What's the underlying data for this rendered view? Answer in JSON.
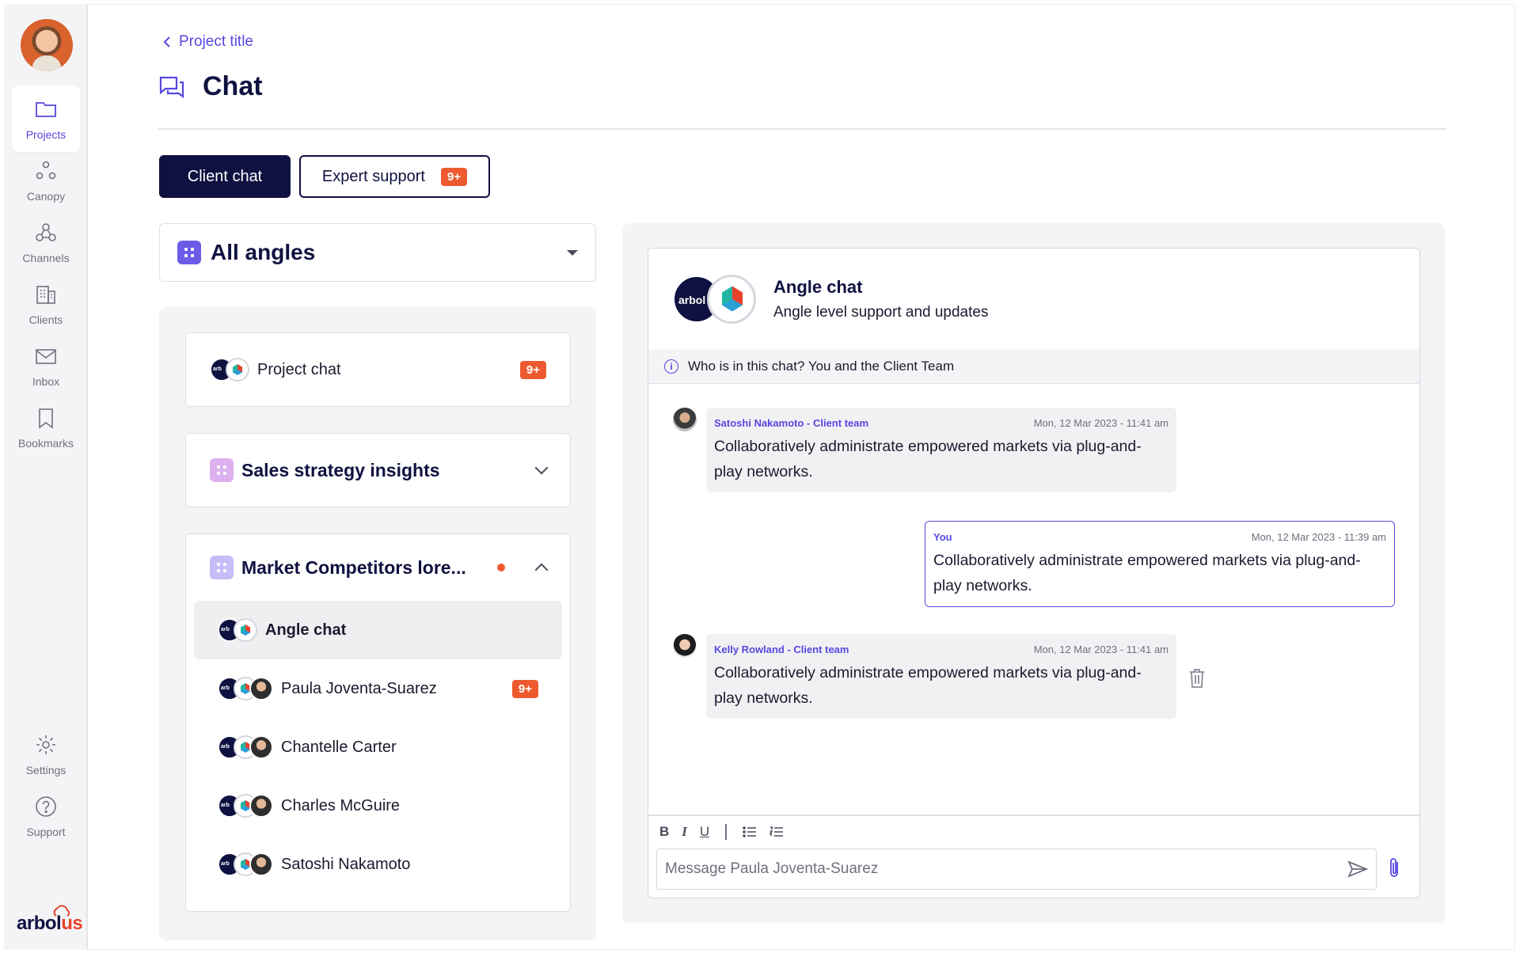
{
  "sidebar": {
    "items": [
      {
        "label": "Projects",
        "icon": "folder-icon",
        "active": true
      },
      {
        "label": "Canopy",
        "icon": "canopy-icon"
      },
      {
        "label": "Channels",
        "icon": "channels-icon"
      },
      {
        "label": "Clients",
        "icon": "building-icon"
      },
      {
        "label": "Inbox",
        "icon": "mail-icon"
      },
      {
        "label": "Bookmarks",
        "icon": "bookmark-icon"
      },
      {
        "label": "Settings",
        "icon": "gear-icon"
      },
      {
        "label": "Support",
        "icon": "help-icon"
      }
    ],
    "logo": {
      "prefix": "arbol",
      "suffix": "us"
    }
  },
  "header": {
    "back_label": "Project title",
    "title": "Chat"
  },
  "tabs": {
    "client_chat": "Client chat",
    "expert_support": "Expert support",
    "expert_support_badge": "9+"
  },
  "angle_select": {
    "value": "All angles"
  },
  "list": {
    "project_chat": {
      "label": "Project chat",
      "badge": "9+"
    },
    "sales_group": {
      "label": "Sales strategy insights"
    },
    "market_group": {
      "label": "Market Competitors lore...",
      "items": [
        {
          "label": "Angle chat",
          "selected": true
        },
        {
          "label": "Paula Joventa-Suarez",
          "badge": "9+"
        },
        {
          "label": "Chantelle Carter"
        },
        {
          "label": "Charles McGuire"
        },
        {
          "label": "Satoshi Nakamoto"
        }
      ]
    }
  },
  "chat": {
    "title": "Angle chat",
    "subtitle": "Angle level support and updates",
    "info": "Who is in this chat? You and the Client Team",
    "messages": [
      {
        "sender": "Satoshi Nakamoto - Client team",
        "time": "Mon, 12 Mar 2023 - 11:41 am",
        "text": "Collaboratively administrate empowered markets via plug-and-play networks.",
        "direction": "in"
      },
      {
        "sender": "You",
        "time": "Mon, 12 Mar 2023 - 11:39 am",
        "text": "Collaboratively administrate empowered markets via plug-and-play networks.",
        "direction": "out"
      },
      {
        "sender": "Kelly Rowland - Client team",
        "time": "Mon, 12 Mar 2023 - 11:41 am",
        "text": "Collaboratively administrate empowered markets via plug-and-play networks.",
        "direction": "in"
      }
    ],
    "composer": {
      "format_bold": "B",
      "format_italic": "I",
      "format_underline": "U",
      "placeholder": "Message Paula Joventa-Suarez"
    }
  },
  "colors": {
    "accent": "#5648e0",
    "navy": "#0f1140",
    "badge": "#ee5a2f"
  }
}
